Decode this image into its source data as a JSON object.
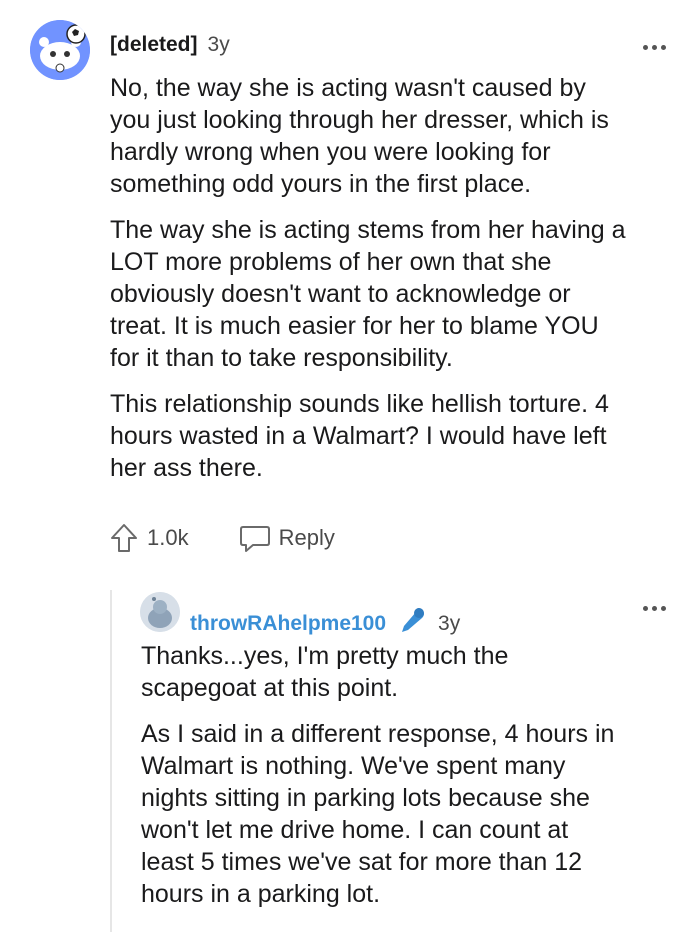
{
  "comments": [
    {
      "author": "[deleted]",
      "age": "3y",
      "paragraphs": [
        "No, the way she is acting wasn't caused by\nyou just looking through her dresser, which is\nhardly wrong when you were looking for\nsomething odd yours in the first place.",
        "The way she is acting stems from her having a\nLOT more problems of her own that she\nobviously doesn't want to acknowledge or\ntreat. It is much easier for her to blame YOU\nfor it than to take responsibility.",
        "This relationship sounds like hellish torture. 4\nhours wasted in a Walmart? I would have left\nher ass there."
      ],
      "upvotes": "1.0k",
      "reply_label": "Reply"
    },
    {
      "author": "throwRAhelpme100",
      "age": "3y",
      "paragraphs": [
        "Thanks...yes, I'm pretty much the\nscapegoat at this point.",
        "As I said in a different response, 4 hours in\nWalmart is nothing. We've spent many\nnights sitting in parking lots because she\nwon't let me drive home. I can count at\nleast 5 times we've sat for more than 12\nhours in a parking lot."
      ]
    }
  ],
  "icons": {
    "upvote": "upvote-arrow-icon",
    "reply": "speech-bubble-icon",
    "more": "ellipsis-icon",
    "flair": "microphone-icon"
  },
  "colors": {
    "username_link": "#3a8fd6",
    "avatar_bg": "#7193ff",
    "thread_line": "#e6e6e6"
  }
}
